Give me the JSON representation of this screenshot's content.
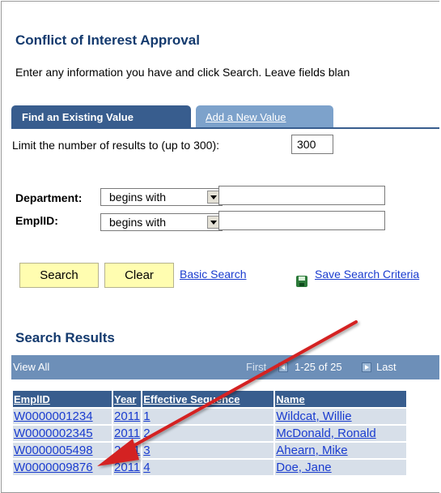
{
  "page": {
    "title": "Conflict of Interest Approval",
    "instructions": "Enter any information you have and click Search. Leave fields blan"
  },
  "tabs": [
    {
      "label": "Find an Existing Value"
    },
    {
      "label": "Add a New Value"
    }
  ],
  "limit": {
    "label": "Limit the number of results to (up to 300):",
    "value": "300"
  },
  "fields": [
    {
      "label": "Department:",
      "operator": "begins with",
      "value": ""
    },
    {
      "label": "EmplID:",
      "operator": "begins with",
      "value": ""
    }
  ],
  "buttons": {
    "search": "Search",
    "clear": "Clear",
    "basic_search": "Basic Search",
    "save_criteria": "Save Search Criteria"
  },
  "results": {
    "title": "Search Results",
    "view_all": "View All",
    "first": "First",
    "range": "1-25 of 25",
    "last": "Last",
    "columns": [
      "EmplID",
      "Year",
      "Effective Sequence",
      "Name"
    ],
    "rows": [
      [
        "W0000001234",
        "2011",
        "1",
        "Wildcat, Willie"
      ],
      [
        "W0000002345",
        "2011",
        "2",
        "McDonald, Ronald"
      ],
      [
        "W0000005498",
        "2011",
        "3",
        "Ahearn, Mike"
      ],
      [
        "W0000009876",
        "2011",
        "4",
        "Doe, Jane"
      ]
    ]
  },
  "colors": {
    "title": "#143a6e",
    "tab_active": "#385d8e",
    "tab_inactive": "#7da2cb",
    "button": "#fffdb0",
    "link": "#1a3ccf",
    "annotation_arrow": "#d42020"
  }
}
